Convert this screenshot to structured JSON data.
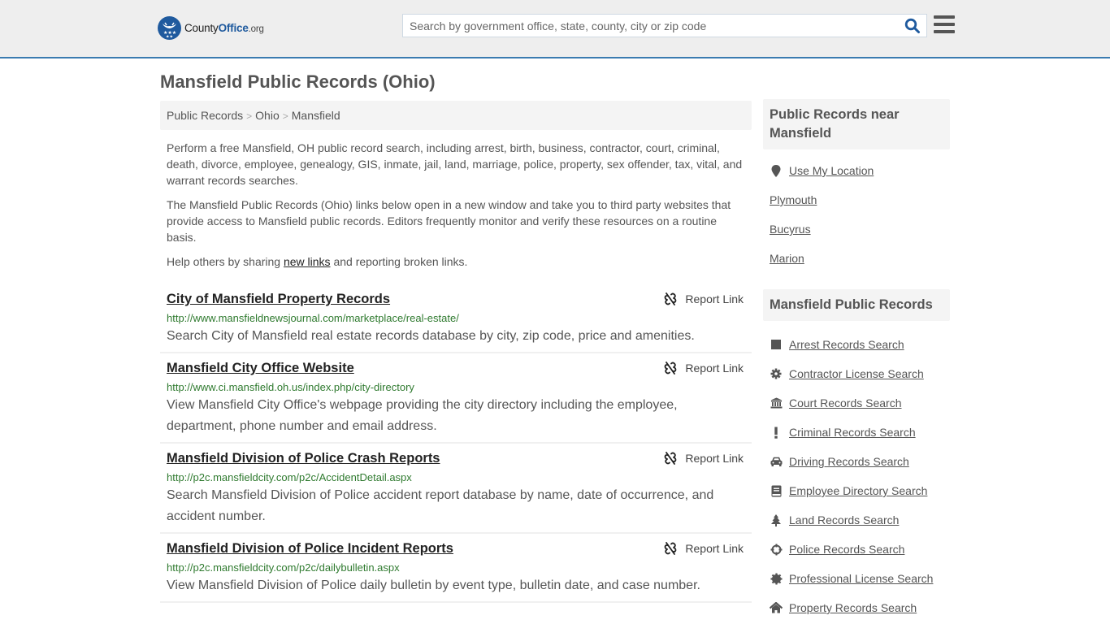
{
  "header": {
    "logo": {
      "county": "County",
      "office": "Office",
      "org": ".org"
    },
    "search_placeholder": "Search by government office, state, county, city or zip code",
    "search_value": ""
  },
  "page_title": "Mansfield Public Records (Ohio)",
  "breadcrumb": [
    {
      "label": "Public Records"
    },
    {
      "label": "Ohio"
    },
    {
      "label": "Mansfield"
    }
  ],
  "intro": {
    "p1": "Perform a free Mansfield, OH public record search, including arrest, birth, business, contractor, court, criminal, death, divorce, employee, genealogy, GIS, inmate, jail, land, marriage, police, property, sex offender, tax, vital, and warrant records searches.",
    "p2": "The Mansfield Public Records (Ohio) links below open in a new window and take you to third party websites that provide access to Mansfield public records. Editors frequently monitor and verify these resources on a routine basis.",
    "p3_before": "Help others by sharing ",
    "p3_link": "new links",
    "p3_after": " and reporting broken links."
  },
  "report_label": "Report Link",
  "results": [
    {
      "title": "City of Mansfield Property Records",
      "url": "http://www.mansfieldnewsjournal.com/marketplace/real-estate/",
      "desc": "Search City of Mansfield real estate records database by city, zip code, price and amenities."
    },
    {
      "title": "Mansfield City Office Website",
      "url": "http://www.ci.mansfield.oh.us/index.php/city-directory",
      "desc": "View Mansfield City Office's webpage providing the city directory including the employee, department, phone number and email address."
    },
    {
      "title": "Mansfield Division of Police Crash Reports",
      "url": "http://p2c.mansfieldcity.com/p2c/AccidentDetail.aspx",
      "desc": "Search Mansfield Division of Police accident report database by name, date of occurrence, and accident number."
    },
    {
      "title": "Mansfield Division of Police Incident Reports",
      "url": "http://p2c.mansfieldcity.com/p2c/dailybulletin.aspx",
      "desc": "View Mansfield Division of Police daily bulletin by event type, bulletin date, and case number."
    }
  ],
  "sidebar": {
    "near_heading": "Public Records near Mansfield",
    "use_location": "Use My Location",
    "near_places": [
      "Plymouth",
      "Bucyrus",
      "Marion"
    ],
    "records_heading": "Mansfield Public Records",
    "records": [
      {
        "label": "Arrest Records Search",
        "icon": "square-icon"
      },
      {
        "label": "Contractor License Search",
        "icon": "gear-icon"
      },
      {
        "label": "Court Records Search",
        "icon": "courthouse-icon"
      },
      {
        "label": "Criminal Records Search",
        "icon": "exclamation-icon"
      },
      {
        "label": "Driving Records Search",
        "icon": "car-icon"
      },
      {
        "label": "Employee Directory Search",
        "icon": "book-icon"
      },
      {
        "label": "Land Records Search",
        "icon": "tree-icon"
      },
      {
        "label": "Police Records Search",
        "icon": "crosshairs-icon"
      },
      {
        "label": "Professional License Search",
        "icon": "certificate-icon"
      },
      {
        "label": "Property Records Search",
        "icon": "home-icon"
      }
    ]
  },
  "colors": {
    "brand_blue": "#1f5a9e",
    "header_border": "#3a7bb0",
    "url_green": "#2f7a2f"
  }
}
